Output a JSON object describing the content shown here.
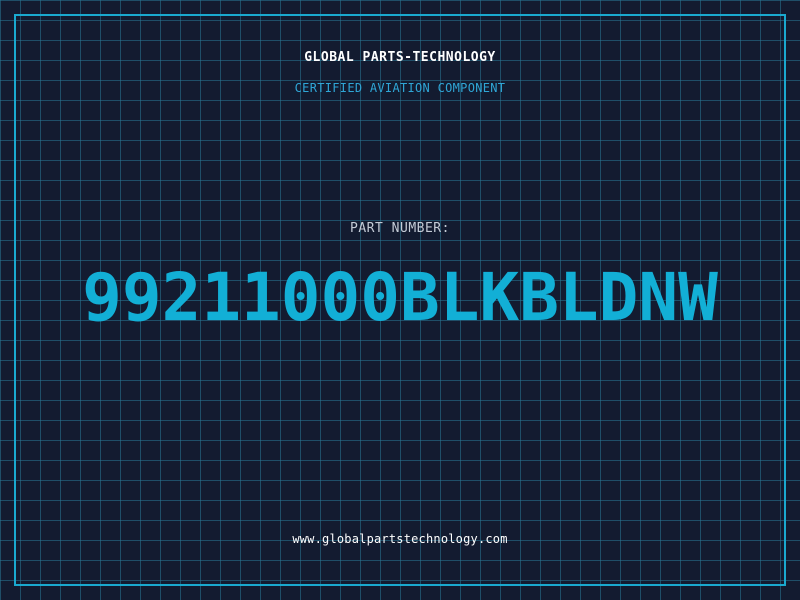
{
  "header": {
    "company": "GLOBAL PARTS-TECHNOLOGY",
    "subtitle": "CERTIFIED AVIATION COMPONENT"
  },
  "part": {
    "label": "PART NUMBER:",
    "number": "99211000BLKBLDNW"
  },
  "footer": {
    "website": "www.globalpartstechnology.com"
  },
  "colors": {
    "background": "#131b30",
    "grid": "#28789a",
    "frame": "#1aa9cf",
    "accent": "#12afd6"
  }
}
